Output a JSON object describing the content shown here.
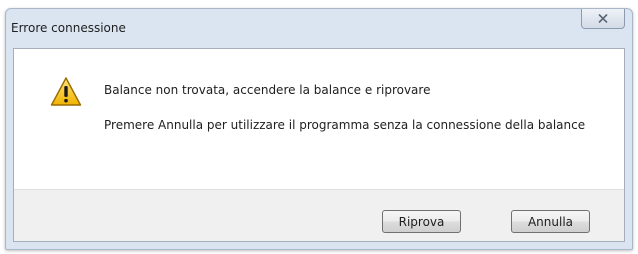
{
  "dialog": {
    "title": "Errore connessione",
    "icon": "warning-icon",
    "message_primary": "Balance non trovata, accendere la balance e riprovare",
    "message_secondary": "Premere Annulla per utilizzare il programma senza la connessione della balance",
    "buttons": {
      "retry_label": "Riprova",
      "cancel_label": "Annulla"
    },
    "close_icon": "close-icon"
  },
  "colors": {
    "frame": "#dbe5f1",
    "footer": "#f0f0f0",
    "warning_fill": "#f5c518",
    "warning_outline": "#9a6b00"
  }
}
